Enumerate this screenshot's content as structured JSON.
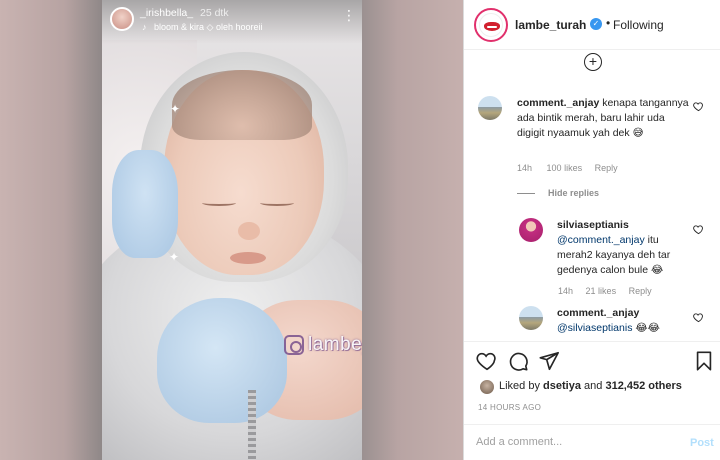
{
  "story": {
    "username": "_irishbella_",
    "time": "25 dtk",
    "music": "bloom & kira",
    "music_sep": "◇",
    "music_artist": "oleh hooreii",
    "watermark": "lambe_turah"
  },
  "header": {
    "username": "lambe_turah",
    "follow_status": "Following"
  },
  "comments": [
    {
      "username": "comment._anjay",
      "text": "kenapa tangannya ada bintik merah, baru lahir uda digigit nyaamuk yah dek 😅",
      "time": "14h",
      "likes": "100 likes",
      "reply": "Reply"
    }
  ],
  "hide_replies": "Hide replies",
  "replies": [
    {
      "username": "silviaseptianis",
      "mention": "@comment._anjay",
      "text": "itu merah2 kayanya deh tar gedenya calon bule 😂",
      "time": "14h",
      "likes": "21 likes",
      "reply": "Reply"
    },
    {
      "username": "comment._anjay",
      "mention": "@silviaseptianis",
      "text": "😂😂"
    }
  ],
  "likes": {
    "prefix": "Liked by",
    "user": "dsetiya",
    "middle": "and",
    "count": "312,452 others"
  },
  "posted_ago": "14 HOURS AGO",
  "add_comment": {
    "placeholder": "Add a comment...",
    "post_label": "Post"
  },
  "colors": {
    "verified": "#3897f0",
    "post_disabled": "#b2dffc",
    "secondary_text": "#8e8e8e",
    "brand_lips": "#d2202e"
  }
}
